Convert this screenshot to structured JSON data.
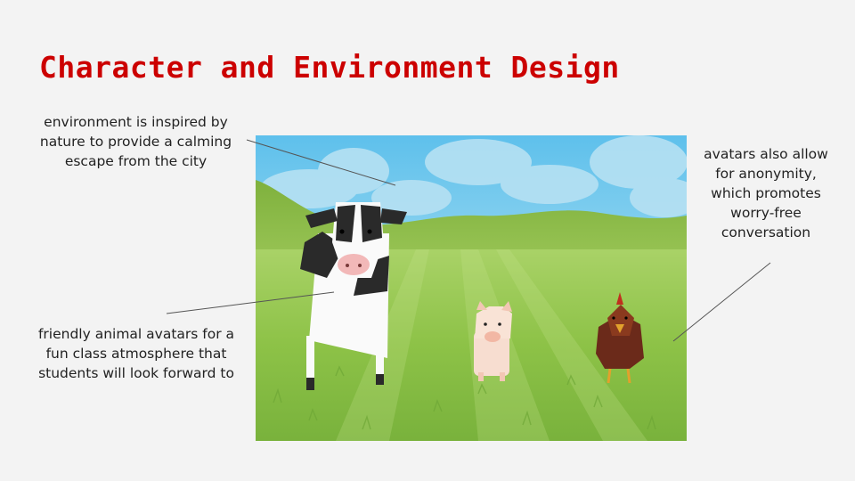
{
  "slide": {
    "title": "Character and Environment Design"
  },
  "notes": {
    "environment": [
      "environment is inspired by",
      "nature to provide a calming",
      "escape from the city"
    ],
    "anonymity": [
      "avatars also allow",
      "for anonymity,",
      "which promotes",
      "worry-free",
      "conversation"
    ],
    "avatars": [
      "friendly animal avatars for a",
      "fun class atmosphere that",
      "students will look forward to"
    ]
  },
  "colors": {
    "title": "#cc0000",
    "background": "#f3f3f3",
    "sky": "#72c6ea",
    "grass": "#8fc24a"
  },
  "scene": {
    "characters": [
      "cow-avatar",
      "pig-avatar",
      "chicken-avatar"
    ]
  }
}
